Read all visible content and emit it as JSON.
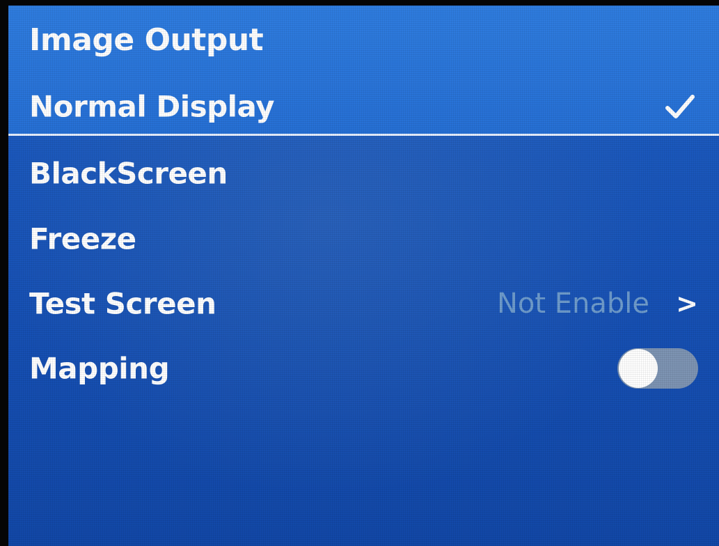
{
  "header": {
    "title": "Image Output",
    "selected_item": {
      "label": "Normal Display",
      "checked": true,
      "check_icon": "checkmark-icon"
    }
  },
  "menu": {
    "items": [
      {
        "label": "BlackScreen"
      },
      {
        "label": "Freeze"
      },
      {
        "label": "Test Screen",
        "value": "Not Enable",
        "chevron": ">"
      },
      {
        "label": "Mapping",
        "toggle_on": false
      }
    ]
  },
  "colors": {
    "background": "#1a57bc",
    "header_background": "#2670d6",
    "text": "#ffffff",
    "muted_value": "#6f9ccc",
    "toggle_track": "#7d94b3"
  }
}
